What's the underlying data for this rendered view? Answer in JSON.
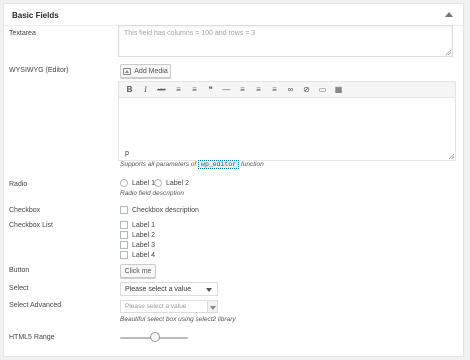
{
  "panel": {
    "title": "Basic Fields"
  },
  "textarea": {
    "label": "Textarea",
    "placeholder": "This field has columns = 100 and rows = 3"
  },
  "wysiwyg": {
    "label": "WYSIWYG (Editor)",
    "add_media": "Add Media",
    "toolbar": [
      {
        "name": "bold-icon",
        "glyph": "B"
      },
      {
        "name": "italic-icon",
        "glyph": "I"
      },
      {
        "name": "strikethrough-icon",
        "glyph": "ABC"
      },
      {
        "name": "bullet-list-icon",
        "glyph": "≡"
      },
      {
        "name": "numbered-list-icon",
        "glyph": "≡"
      },
      {
        "name": "blockquote-icon",
        "glyph": "❝"
      },
      {
        "name": "horizontal-rule-icon",
        "glyph": "—"
      },
      {
        "name": "align-left-icon",
        "glyph": "≡"
      },
      {
        "name": "align-center-icon",
        "glyph": "≡"
      },
      {
        "name": "align-right-icon",
        "glyph": "≡"
      },
      {
        "name": "insert-link-icon",
        "glyph": "∞"
      },
      {
        "name": "remove-link-icon",
        "glyph": "⊘"
      },
      {
        "name": "read-more-icon",
        "glyph": "▭"
      },
      {
        "name": "toolbar-toggle-icon",
        "glyph": "▦"
      }
    ],
    "status_path": "p",
    "desc_prefix": "Supports all parameters of",
    "desc_code": "wp_editor",
    "desc_suffix": "function"
  },
  "radio": {
    "label": "Radio",
    "options": [
      "Label 1",
      "Label 2"
    ],
    "desc": "Radio field description"
  },
  "checkbox": {
    "label": "Checkbox",
    "desc": "Checkbox description"
  },
  "checkbox_list": {
    "label": "Checkbox List",
    "options": [
      "Label 1",
      "Label 2",
      "Label 3",
      "Label 4"
    ]
  },
  "button": {
    "label": "Button",
    "text": "Click me"
  },
  "select": {
    "label": "Select",
    "value": "Please select a value"
  },
  "select_advanced": {
    "label": "Select Advanced",
    "placeholder": "Please select a value",
    "desc": "Beautiful select box using select2 library"
  },
  "range": {
    "label": "HTML5 Range",
    "value_fraction": 0.52
  }
}
